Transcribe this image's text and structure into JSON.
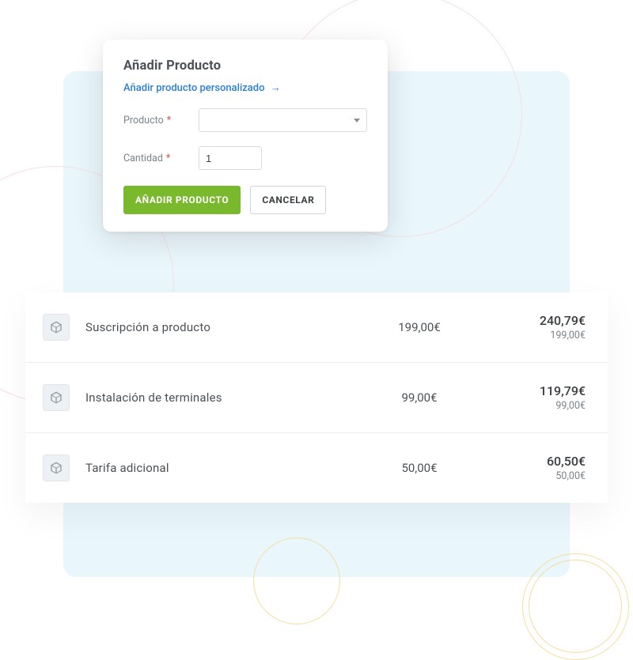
{
  "card": {
    "title": "Añadir Producto",
    "custom_link": "Añadir producto personalizado",
    "arrow": "→",
    "product_label": "Producto",
    "quantity_label": "Cantidad",
    "required_mark": "*",
    "quantity_value": "1",
    "submit": "AÑADIR PRODUCTO",
    "cancel": "CANCELAR"
  },
  "products": [
    {
      "name": "Suscripción a producto",
      "unit": "199,00€",
      "total_gross": "240,79€",
      "total_net": "199,00€"
    },
    {
      "name": "Instalación de terminales",
      "unit": "99,00€",
      "total_gross": "119,79€",
      "total_net": "99,00€"
    },
    {
      "name": "Tarifa adicional",
      "unit": "50,00€",
      "total_gross": "60,50€",
      "total_net": "50,00€"
    }
  ]
}
